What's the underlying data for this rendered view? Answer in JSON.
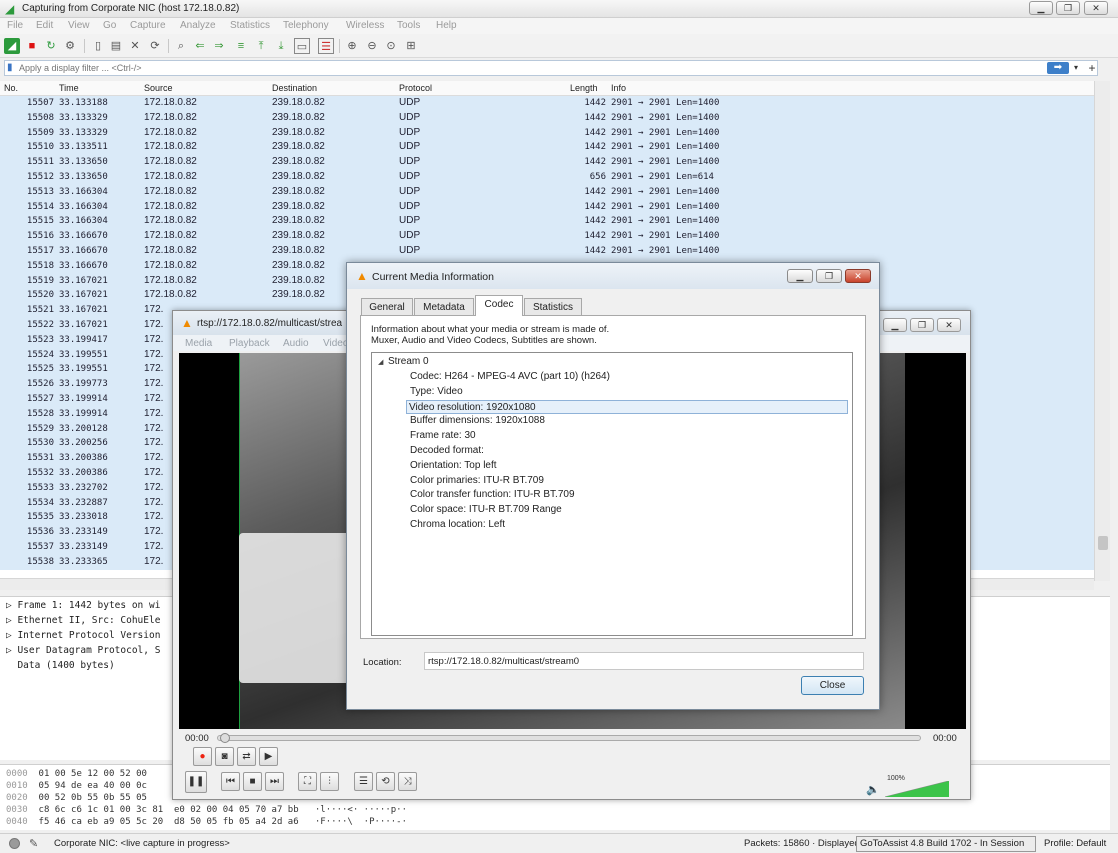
{
  "wireshark": {
    "title": "Capturing from Corporate NIC (host 172.18.0.82)",
    "menu": [
      "File",
      "Edit",
      "View",
      "Go",
      "Capture",
      "Analyze",
      "Statistics",
      "Telephony",
      "Wireless",
      "Tools",
      "Help"
    ],
    "filter_placeholder": "Apply a display filter ... <Ctrl-/>",
    "columns": [
      "No.",
      "Time",
      "Source",
      "Destination",
      "Protocol",
      "Length",
      "Info"
    ],
    "packets": [
      {
        "no": "15507",
        "time": "33.133188",
        "src": "172.18.0.82",
        "dst": "239.18.0.82",
        "proto": "UDP",
        "len": "1442",
        "info": "2901 → 2901 Len=1400"
      },
      {
        "no": "15508",
        "time": "33.133329",
        "src": "172.18.0.82",
        "dst": "239.18.0.82",
        "proto": "UDP",
        "len": "1442",
        "info": "2901 → 2901 Len=1400"
      },
      {
        "no": "15509",
        "time": "33.133329",
        "src": "172.18.0.82",
        "dst": "239.18.0.82",
        "proto": "UDP",
        "len": "1442",
        "info": "2901 → 2901 Len=1400"
      },
      {
        "no": "15510",
        "time": "33.133511",
        "src": "172.18.0.82",
        "dst": "239.18.0.82",
        "proto": "UDP",
        "len": "1442",
        "info": "2901 → 2901 Len=1400"
      },
      {
        "no": "15511",
        "time": "33.133650",
        "src": "172.18.0.82",
        "dst": "239.18.0.82",
        "proto": "UDP",
        "len": "1442",
        "info": "2901 → 2901 Len=1400"
      },
      {
        "no": "15512",
        "time": "33.133650",
        "src": "172.18.0.82",
        "dst": "239.18.0.82",
        "proto": "UDP",
        "len": "656",
        "info": "2901 → 2901 Len=614"
      },
      {
        "no": "15513",
        "time": "33.166304",
        "src": "172.18.0.82",
        "dst": "239.18.0.82",
        "proto": "UDP",
        "len": "1442",
        "info": "2901 → 2901 Len=1400"
      },
      {
        "no": "15514",
        "time": "33.166304",
        "src": "172.18.0.82",
        "dst": "239.18.0.82",
        "proto": "UDP",
        "len": "1442",
        "info": "2901 → 2901 Len=1400"
      },
      {
        "no": "15515",
        "time": "33.166304",
        "src": "172.18.0.82",
        "dst": "239.18.0.82",
        "proto": "UDP",
        "len": "1442",
        "info": "2901 → 2901 Len=1400"
      },
      {
        "no": "15516",
        "time": "33.166670",
        "src": "172.18.0.82",
        "dst": "239.18.0.82",
        "proto": "UDP",
        "len": "1442",
        "info": "2901 → 2901 Len=1400"
      },
      {
        "no": "15517",
        "time": "33.166670",
        "src": "172.18.0.82",
        "dst": "239.18.0.82",
        "proto": "UDP",
        "len": "1442",
        "info": "2901 → 2901 Len=1400"
      },
      {
        "no": "15518",
        "time": "33.166670",
        "src": "172.18.0.82",
        "dst": "239.18.0.82",
        "proto": "",
        "len": "",
        "info": ""
      },
      {
        "no": "15519",
        "time": "33.167021",
        "src": "172.18.0.82",
        "dst": "239.18.0.82",
        "proto": "",
        "len": "",
        "info": ""
      },
      {
        "no": "15520",
        "time": "33.167021",
        "src": "172.18.0.82",
        "dst": "239.18.0.82",
        "proto": "",
        "len": "",
        "info": ""
      },
      {
        "no": "15521",
        "time": "33.167021",
        "src": "172.",
        "dst": "",
        "proto": "",
        "len": "",
        "info": ""
      },
      {
        "no": "15522",
        "time": "33.167021",
        "src": "172.",
        "dst": "",
        "proto": "",
        "len": "",
        "info": ""
      },
      {
        "no": "15523",
        "time": "33.199417",
        "src": "172.",
        "dst": "",
        "proto": "",
        "len": "",
        "info": ""
      },
      {
        "no": "15524",
        "time": "33.199551",
        "src": "172.",
        "dst": "",
        "proto": "",
        "len": "",
        "info": ""
      },
      {
        "no": "15525",
        "time": "33.199551",
        "src": "172.",
        "dst": "",
        "proto": "",
        "len": "",
        "info": ""
      },
      {
        "no": "15526",
        "time": "33.199773",
        "src": "172.",
        "dst": "",
        "proto": "",
        "len": "",
        "info": ""
      },
      {
        "no": "15527",
        "time": "33.199914",
        "src": "172.",
        "dst": "",
        "proto": "",
        "len": "",
        "info": ""
      },
      {
        "no": "15528",
        "time": "33.199914",
        "src": "172.",
        "dst": "",
        "proto": "",
        "len": "",
        "info": ""
      },
      {
        "no": "15529",
        "time": "33.200128",
        "src": "172.",
        "dst": "",
        "proto": "",
        "len": "",
        "info": ""
      },
      {
        "no": "15530",
        "time": "33.200256",
        "src": "172.",
        "dst": "",
        "proto": "",
        "len": "",
        "info": ""
      },
      {
        "no": "15531",
        "time": "33.200386",
        "src": "172.",
        "dst": "",
        "proto": "",
        "len": "",
        "info": ""
      },
      {
        "no": "15532",
        "time": "33.200386",
        "src": "172.",
        "dst": "",
        "proto": "",
        "len": "",
        "info": ""
      },
      {
        "no": "15533",
        "time": "33.232702",
        "src": "172.",
        "dst": "",
        "proto": "",
        "len": "",
        "info": ""
      },
      {
        "no": "15534",
        "time": "33.232887",
        "src": "172.",
        "dst": "",
        "proto": "",
        "len": "",
        "info": ""
      },
      {
        "no": "15535",
        "time": "33.233018",
        "src": "172.",
        "dst": "",
        "proto": "",
        "len": "",
        "info": ""
      },
      {
        "no": "15536",
        "time": "33.233149",
        "src": "172.",
        "dst": "",
        "proto": "",
        "len": "",
        "info": ""
      },
      {
        "no": "15537",
        "time": "33.233149",
        "src": "172.",
        "dst": "",
        "proto": "",
        "len": "",
        "info": ""
      },
      {
        "no": "15538",
        "time": "33.233365",
        "src": "172.",
        "dst": "",
        "proto": "",
        "len": "",
        "info": ""
      }
    ],
    "details": [
      "Frame 1: 1442 bytes on wi",
      "Ethernet II, Src: CohuEle",
      "Internet Protocol Version",
      "User Datagram Protocol, S",
      "Data (1400 bytes)"
    ],
    "bytes": [
      {
        "offset": "0000",
        "hex": "01 00 5e 12 00 52 00",
        "ascii": ""
      },
      {
        "offset": "0010",
        "hex": "05 94 de ea 40 00 0c",
        "ascii": ""
      },
      {
        "offset": "0020",
        "hex": "00 52 0b 55 0b 55 05",
        "ascii": ""
      },
      {
        "offset": "0030",
        "hex": "c8 6c c6 1c 01 00 3c 81  e0 02 00 04 05 70 a7 bb",
        "ascii": "·l····<· ·····p··"
      },
      {
        "offset": "0040",
        "hex": "f5 46 ca eb a9 05 5c 20  d8 50 05 fb 05 a4 2d a6",
        "ascii": "·F····\\  ·P····-·"
      }
    ],
    "status": {
      "capture": "Corporate NIC: <live capture in progress>",
      "packets": "Packets: 15860 · Displayed",
      "overlay": "GoToAssist 4.8 Build 1702 - In Session",
      "profile": "Profile: Default"
    }
  },
  "vlc": {
    "title": "rtsp://172.18.0.82/multicast/strea",
    "menu": [
      "Media",
      "Playback",
      "Audio",
      "Video"
    ],
    "time_elapsed": "00:00",
    "time_total": "00:00",
    "volume": "100%",
    "volume_level": 1.0
  },
  "media_info": {
    "title": "Current Media Information",
    "tabs": [
      "General",
      "Metadata",
      "Codec",
      "Statistics"
    ],
    "active_tab": "Codec",
    "description_1": "Information about what your media or stream is made of.",
    "description_2": "Muxer, Audio and Video Codecs, Subtitles are shown.",
    "stream": "Stream 0",
    "properties": [
      "Codec: H264 - MPEG-4 AVC (part 10) (h264)",
      "Type: Video",
      "Video resolution: 1920x1080",
      "Buffer dimensions: 1920x1088",
      "Frame rate: 30",
      "Decoded format:",
      "Orientation: Top left",
      "Color primaries: ITU-R BT.709",
      "Color transfer function: ITU-R BT.709",
      "Color space: ITU-R BT.709 Range",
      "Chroma location: Left"
    ],
    "selected_index": 2,
    "location_label": "Location:",
    "location": "rtsp://172.18.0.82/multicast/stream0",
    "close_label": "Close"
  },
  "colors": {
    "row_bg": "#daeaf8",
    "vlc_orange": "#f08a00",
    "volume_green": "#3cc44a"
  }
}
